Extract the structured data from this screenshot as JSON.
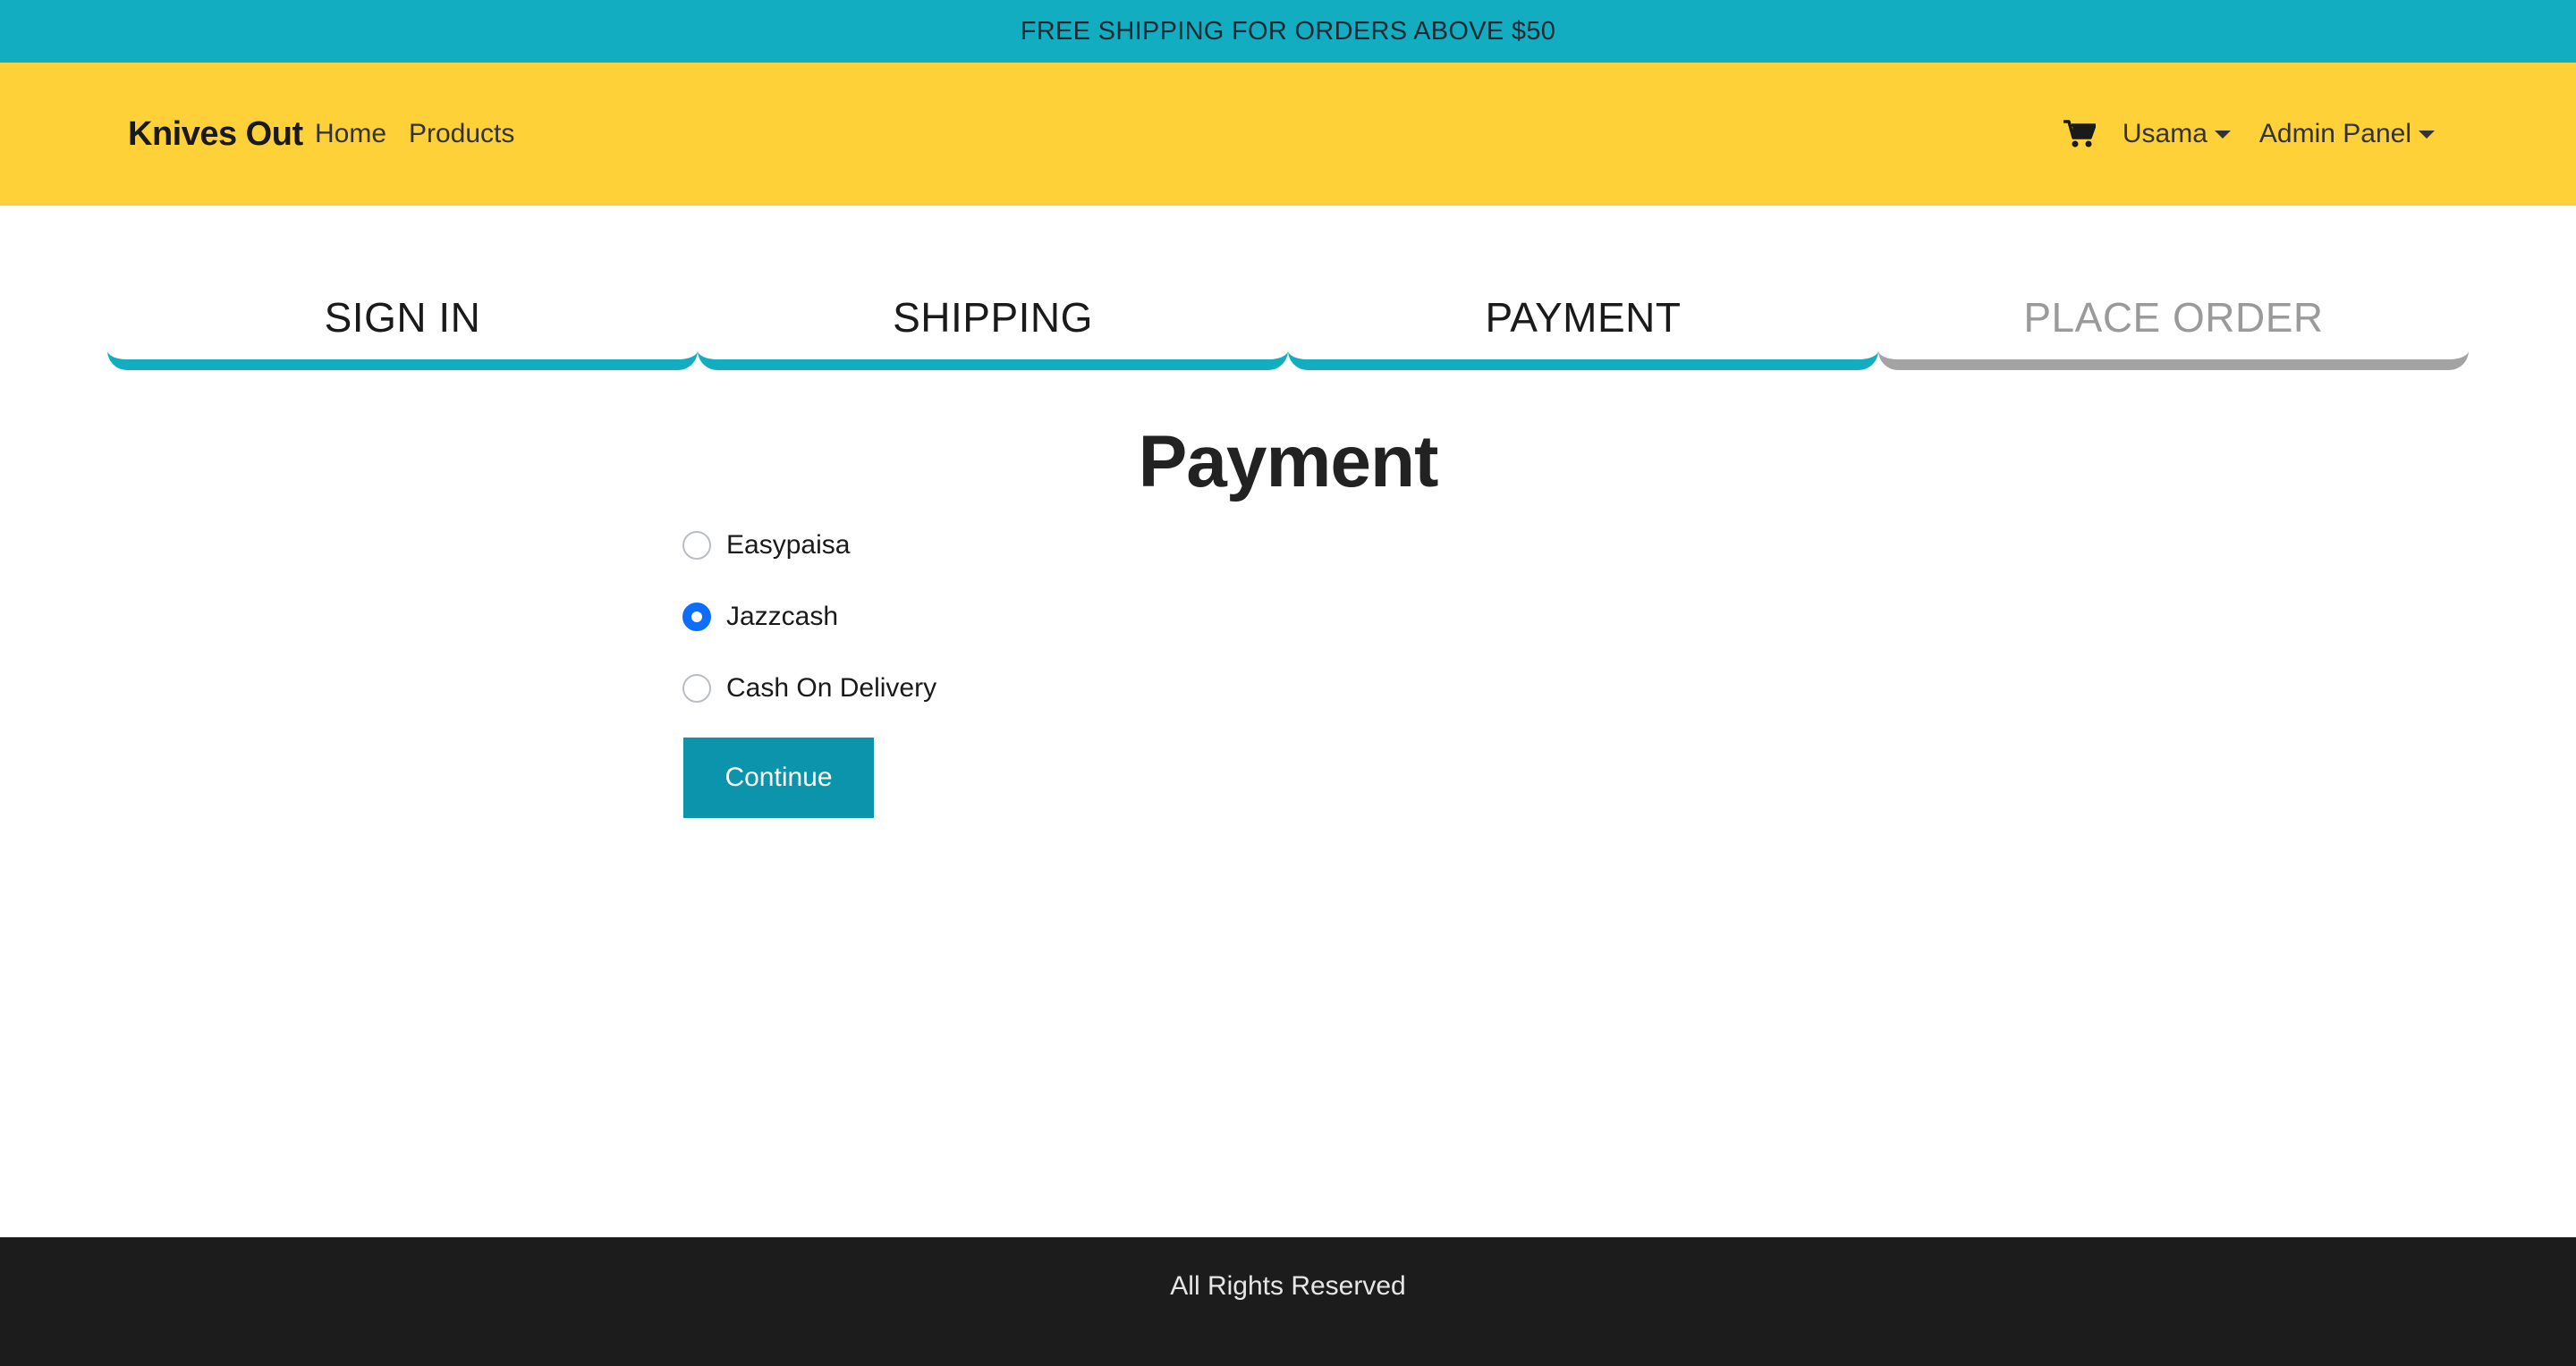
{
  "promo": {
    "text": "FREE SHIPPING FOR ORDERS ABOVE $50"
  },
  "navbar": {
    "brand": "Knives Out",
    "links": [
      "Home",
      "Products"
    ],
    "cart_icon": "shopping-cart-icon",
    "user_menu": "Usama",
    "admin_menu": "Admin Panel"
  },
  "steps": [
    {
      "label": "SIGN IN",
      "active": true
    },
    {
      "label": "SHIPPING",
      "active": true
    },
    {
      "label": "PAYMENT",
      "active": true
    },
    {
      "label": "PLACE ORDER",
      "active": false
    }
  ],
  "payment": {
    "title": "Payment",
    "methods": [
      {
        "label": "Easypaisa",
        "selected": false
      },
      {
        "label": "Jazzcash",
        "selected": true
      },
      {
        "label": "Cash On Delivery",
        "selected": false
      }
    ],
    "continue_label": "Continue"
  },
  "footer": {
    "text": "All Rights Reserved"
  },
  "colors": {
    "promo_bg": "#13adc1",
    "navbar_bg": "#fdd137",
    "step_active": "#13adc1",
    "step_inactive": "#a3a3a3",
    "radio_selected": "#0d6efd",
    "button_bg": "#0d94ad",
    "footer_bg": "#1c1c1c"
  }
}
